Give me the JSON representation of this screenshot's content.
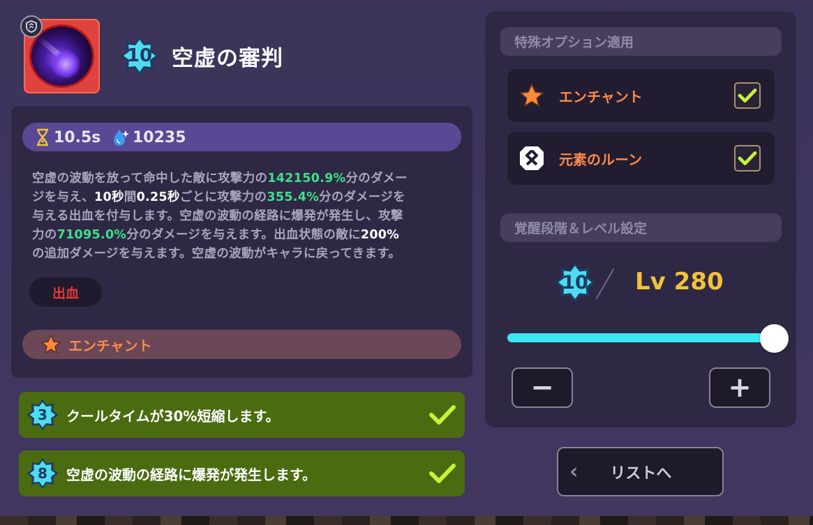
{
  "skill": {
    "level": "10",
    "title": "空虚の審判",
    "cooldown": "10.5s",
    "mana": "10235"
  },
  "description": {
    "l1a": "空虚の波動を放って命中した敵に攻撃力の",
    "l1b": "142150.9%",
    "l1c": "分のダメー",
    "l2a": "ジを与え、",
    "l2b": "10秒",
    "l2c": "間",
    "l2d": "0.25秒",
    "l2e": "ごとに攻撃力の",
    "l2f": "355.4%",
    "l2g": "分のダメージを",
    "l3": "与える出血を付与します。空虚の波動の経路に爆発が発生し、攻撃",
    "l4a": "力の",
    "l4b": "71095.0%",
    "l4c": "分のダメージを与えます。出血状態の敵に",
    "l4d": "200%",
    "l5": "の追加ダメージを与えます。空虚の波動がキャラに戻ってきます。"
  },
  "tags": {
    "bleed": "出血",
    "enchant": "エンチャント"
  },
  "perks": [
    {
      "level": "3",
      "text": "クールタイムが30%短縮します。"
    },
    {
      "level": "8",
      "text": "空虚の波動の経路に爆発が発生します。"
    }
  ],
  "options": {
    "section_title": "特殊オプション適用",
    "enchant_label": "エンチャント",
    "rune_label": "元素のルーン",
    "enchant_checked": true,
    "rune_checked": true
  },
  "awakening": {
    "section_title": "覚醒段階＆レベル設定",
    "stage": "10",
    "level_text": "Lv 280",
    "slider_fraction": 1.0
  },
  "buttons": {
    "minus": "−",
    "plus": "+",
    "list_label": "リストへ",
    "list_chevron": "‹"
  },
  "colors": {
    "accent_cyan": "#3ae8f3",
    "enchant_orange": "#ff8a4a",
    "perk_green": "#4a6b10",
    "level_gold": "#f2c23a"
  }
}
